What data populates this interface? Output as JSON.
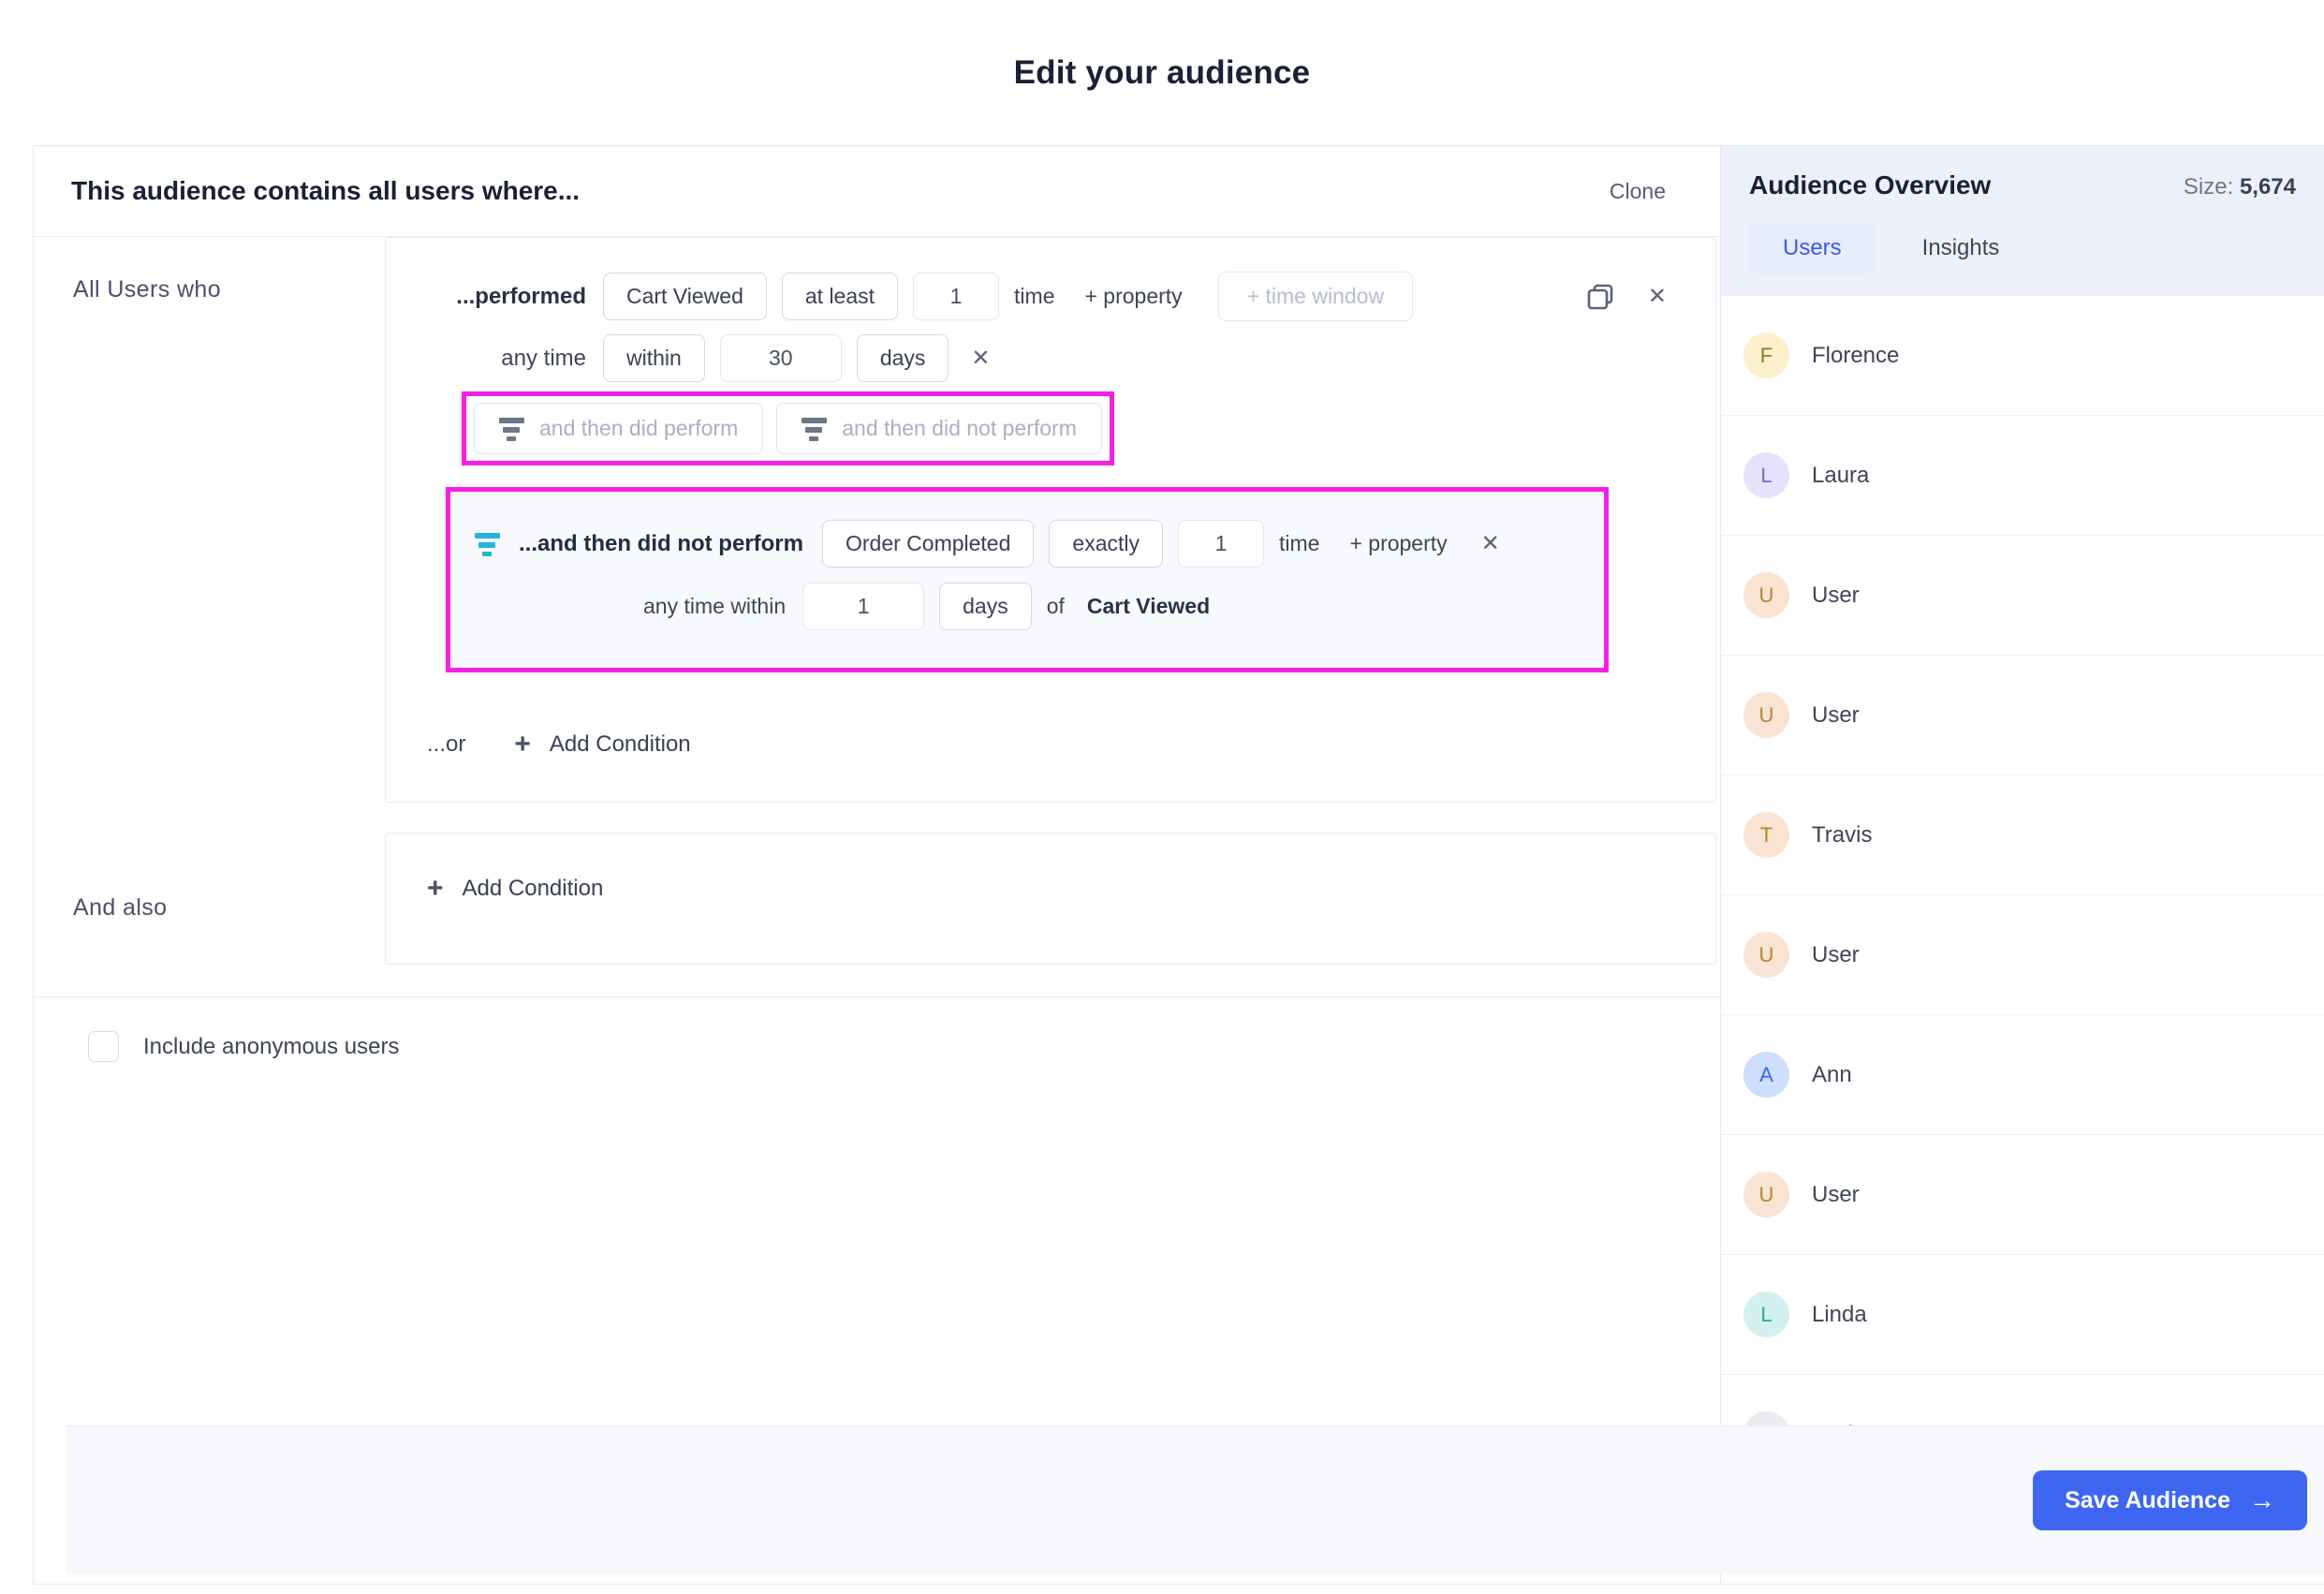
{
  "page": {
    "title": "Edit your audience"
  },
  "builder": {
    "header": {
      "title": "This audience contains all users where...",
      "clone_label": "Clone"
    },
    "all_users_label": "All Users who",
    "and_also_label": "And also",
    "condition1": {
      "performed_label": "...performed",
      "event": "Cart Viewed",
      "operator": "at least",
      "count": "1",
      "time_label": "time",
      "add_property_label": "+ property",
      "time_window_placeholder": "+ time window",
      "anytime_label": "any time",
      "within_operator": "within",
      "window_value": "30",
      "window_unit": "days"
    },
    "followup_buttons": {
      "did_perform": "and then did perform",
      "did_not_perform": "and then did not perform"
    },
    "condition2": {
      "label": "...and then did not perform",
      "event": "Order Completed",
      "operator": "exactly",
      "count": "1",
      "time_label": "time",
      "add_property_label": "+ property",
      "anytime_within_label": "any time within",
      "window_value": "1",
      "window_unit": "days",
      "of_label": "of",
      "of_event": "Cart Viewed"
    },
    "or_label": "...or",
    "add_condition_label": "Add Condition",
    "plus_glyph": "+",
    "close_glyph": "✕",
    "include_anonymous_label": "Include anonymous users"
  },
  "sidebar": {
    "title": "Audience Overview",
    "size_label": "Size:",
    "size_value": "5,674",
    "tabs": [
      {
        "label": "Users",
        "active": true
      },
      {
        "label": "Insights",
        "active": false
      }
    ],
    "users": [
      {
        "name": "Florence",
        "initial": "F",
        "bg": "#fcf0cd",
        "fg": "#96782c"
      },
      {
        "name": "Laura",
        "initial": "L",
        "bg": "#e7e1fb",
        "fg": "#7b62cf"
      },
      {
        "name": "User",
        "initial": "U",
        "bg": "#f9e3d3",
        "fg": "#b9822e"
      },
      {
        "name": "User",
        "initial": "U",
        "bg": "#f9e3d3",
        "fg": "#b9822e"
      },
      {
        "name": "Travis",
        "initial": "T",
        "bg": "#f9e3d3",
        "fg": "#b9822e"
      },
      {
        "name": "User",
        "initial": "U",
        "bg": "#f9e3d3",
        "fg": "#b9822e"
      },
      {
        "name": "Ann",
        "initial": "A",
        "bg": "#cfdefc",
        "fg": "#2f69e8"
      },
      {
        "name": "User",
        "initial": "U",
        "bg": "#f9e3d3",
        "fg": "#b9822e"
      },
      {
        "name": "Linda",
        "initial": "L",
        "bg": "#d2f1ee",
        "fg": "#2fa79d"
      },
      {
        "name": "Craig",
        "initial": "C",
        "bg": "#e9ebf1",
        "fg": "#4a5066"
      }
    ]
  },
  "footer": {
    "save_label": "Save Audience",
    "arrow_glyph": "→"
  },
  "colors": {
    "highlight_magenta": "#f520e4",
    "filter_icon_teal": "#25b4d5",
    "accent_blue": "#3e66f3",
    "sidebar_header_bg": "#eef0f9"
  }
}
